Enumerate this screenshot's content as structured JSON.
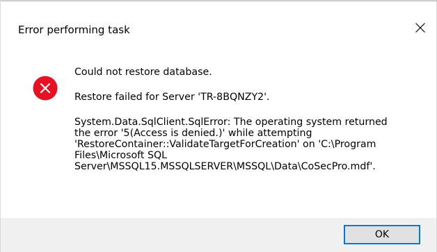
{
  "window": {
    "title": "Error performing task"
  },
  "icons": {
    "close": "close-icon",
    "error": "error-icon"
  },
  "colors": {
    "error_red": "#e81123",
    "button_border": "#0078d7",
    "footer_bg": "#f0f0f0"
  },
  "message": {
    "headline": "Could not restore database.",
    "server_line": "Restore failed for Server 'TR-8BQNZY2'.",
    "details": [
      "System.Data.SqlClient.SqlError: The operating system returned",
      "the error '5(Access is denied.)' while attempting",
      "'RestoreContainer::ValidateTargetForCreation' on 'C:\\Program",
      "Files\\Microsoft SQL",
      "Server\\MSSQL15.MSSQLSERVER\\MSSQL\\Data\\CoSecPro.mdf'."
    ]
  },
  "buttons": {
    "ok_label": "OK"
  }
}
